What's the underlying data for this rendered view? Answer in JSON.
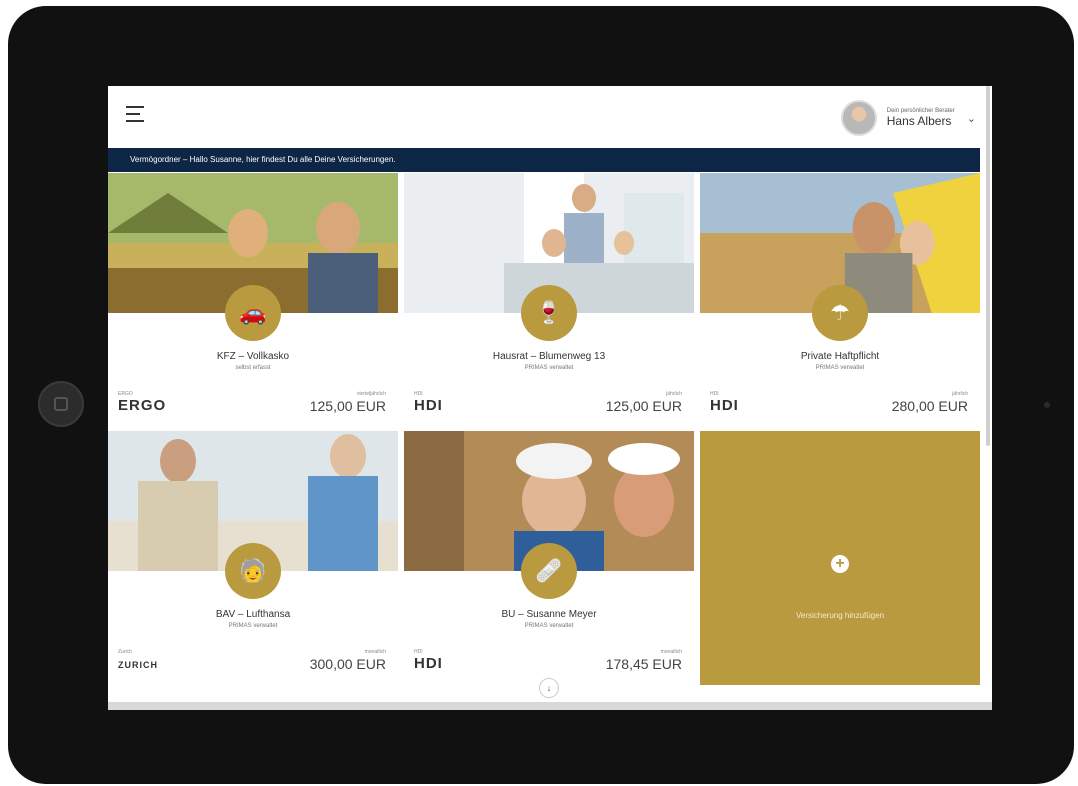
{
  "header": {
    "advisor_caption": "Dein persönlicher Berater",
    "advisor_name": "Hans Albers"
  },
  "banner": {
    "text": "Vermögordner – Hallo Susanne, hier findest Du alle Deine Versicherungen."
  },
  "cards": [
    {
      "title": "KFZ – Vollkasko",
      "subtitle": "selbst erfasst",
      "insurer_caption": "ERGO",
      "insurer": "ERGO",
      "period": "vierteljährlich",
      "amount": "125,00 EUR",
      "icon": "car-icon"
    },
    {
      "title": "Hausrat – Blumenweg 13",
      "subtitle": "PRIMAS verwaltet",
      "insurer_caption": "HDI",
      "insurer": "HDI",
      "period": "jährlich",
      "amount": "125,00 EUR",
      "icon": "glass-icon"
    },
    {
      "title": "Private Haftpflicht",
      "subtitle": "PRIMAS verwaltet",
      "insurer_caption": "HDI",
      "insurer": "HDI",
      "period": "jährlich",
      "amount": "280,00 EUR",
      "icon": "umbrella-icon"
    },
    {
      "title": "BAV – Lufthansa",
      "subtitle": "PRIMAS verwaltet",
      "insurer_caption": "Zurich",
      "insurer": "ZURICH",
      "period": "monatlich",
      "amount": "300,00 EUR",
      "icon": "elderly-icon"
    },
    {
      "title": "BU – Susanne Meyer",
      "subtitle": "PRIMAS verwaltet",
      "insurer_caption": "HDI",
      "insurer": "HDI",
      "period": "monatlich",
      "amount": "178,45 EUR",
      "icon": "bandage-icon"
    }
  ],
  "add_card": {
    "label": "Versicherung hinzufügen"
  },
  "colors": {
    "accent": "#b99a3e",
    "banner": "#0e2646"
  }
}
